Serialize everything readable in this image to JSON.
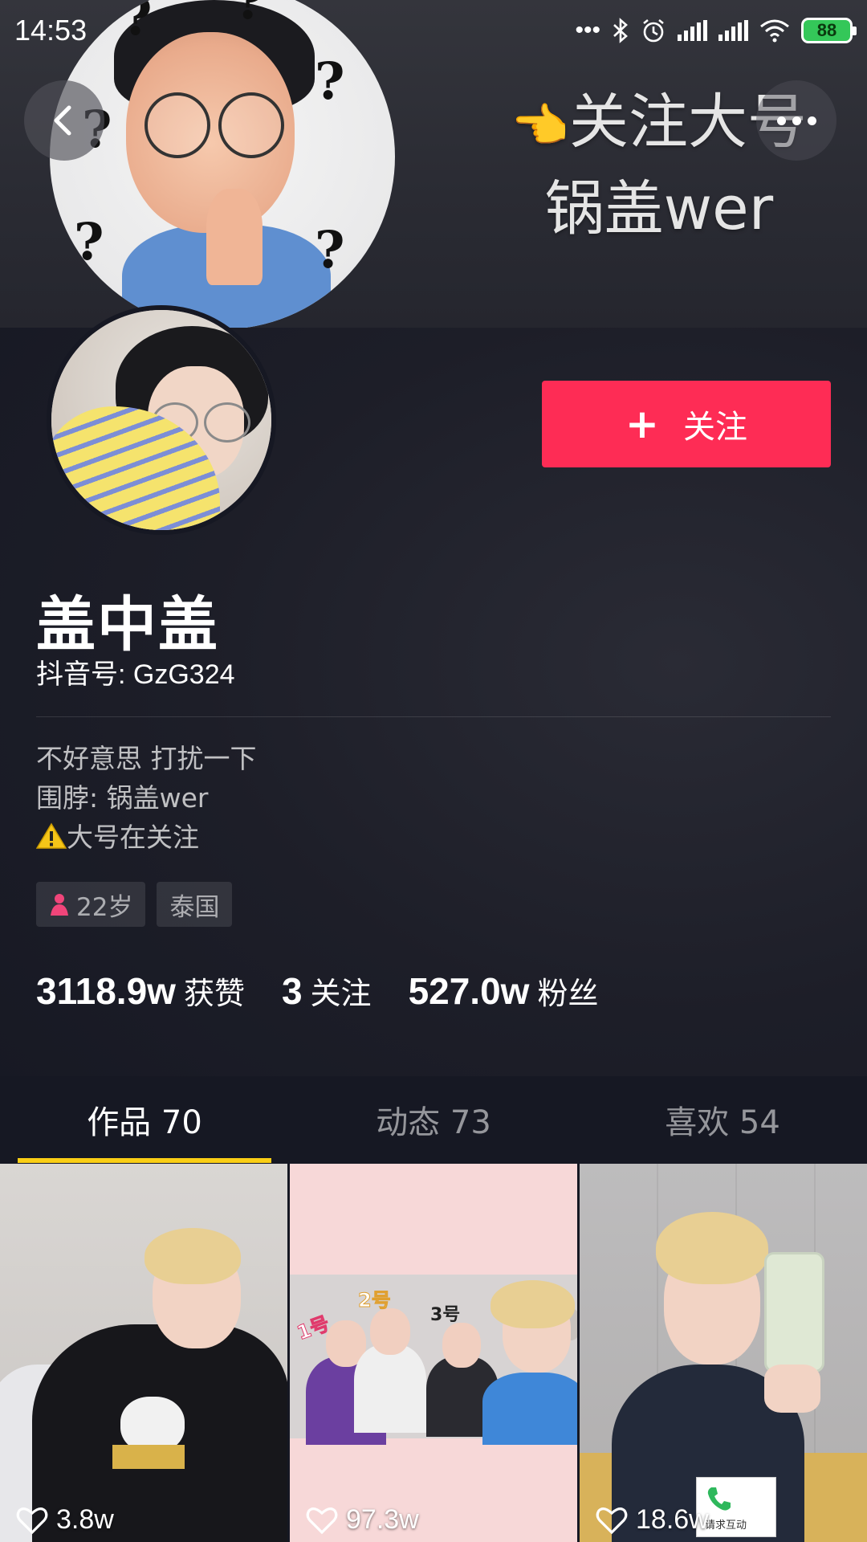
{
  "status_bar": {
    "time": "14:53",
    "battery": "88"
  },
  "cover": {
    "line1": "关注大号",
    "line2": "锅盖wer",
    "hand_emoji": "👈"
  },
  "profile": {
    "name": "盖中盖",
    "account_id": "抖音号: GzG324",
    "follow_button_label": "关注",
    "bio": [
      "不好意思 打扰一下",
      "围脖: 锅盖wer",
      "大号在关注"
    ],
    "tags": {
      "age": "22岁",
      "location": "泰国"
    },
    "stats": {
      "likes_value": "3118.9w",
      "likes_label": "获赞",
      "following_value": "3",
      "following_label": "关注",
      "followers_value": "527.0w",
      "followers_label": "粉丝"
    }
  },
  "tabs": [
    {
      "label": "作品 70",
      "active": true
    },
    {
      "label": "动态 73",
      "active": false
    },
    {
      "label": "喜欢 54",
      "active": false
    }
  ],
  "videos": [
    {
      "likes": "3.8w"
    },
    {
      "likes": "97.3w",
      "label_1": "1号",
      "label_2": "2号",
      "label_3": "3号"
    },
    {
      "likes": "18.6w",
      "sticker_text": "请求互动"
    }
  ],
  "colors": {
    "background": "#161823",
    "follow_button": "#fe2c55",
    "tab_indicator": "#face15",
    "battery": "#34c759"
  },
  "icons": {
    "back": "chevron-left-icon",
    "more": "more-dots-icon",
    "like": "heart-outline-icon",
    "warning": "warning-icon",
    "gender": "female-icon"
  }
}
